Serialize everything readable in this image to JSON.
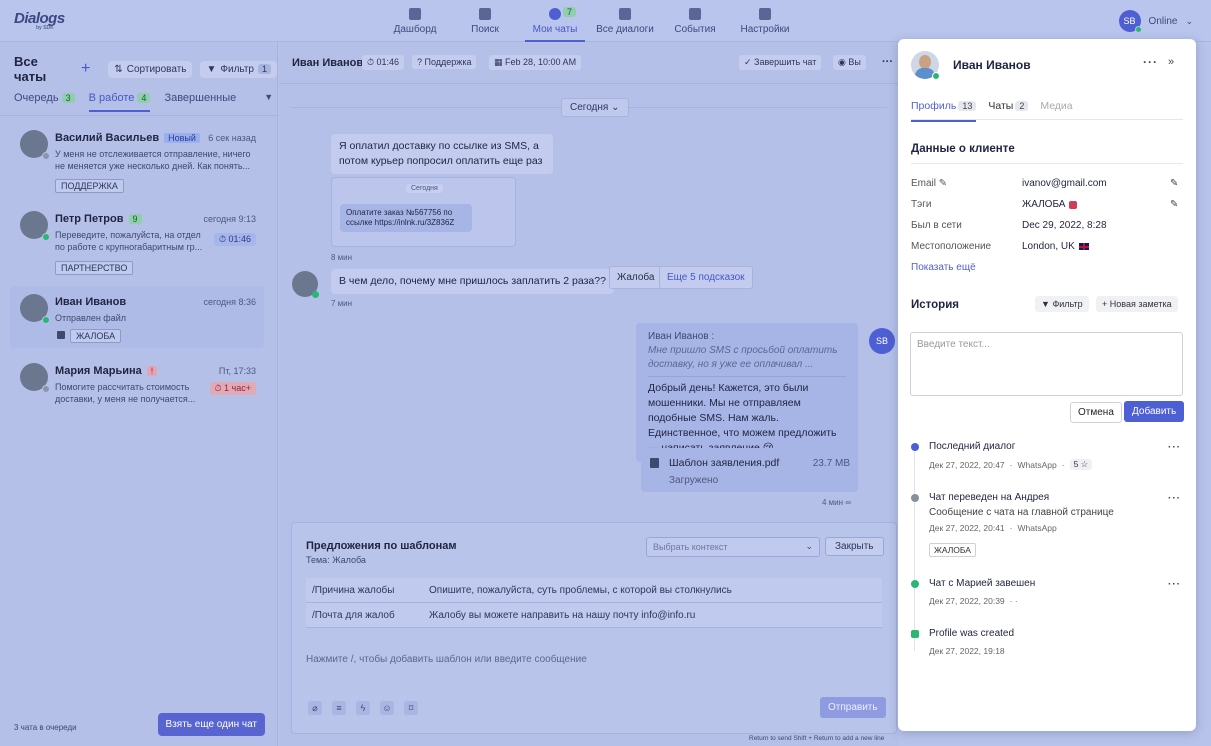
{
  "app": {
    "logo": "Dialogs",
    "logo_sub": "by SDK"
  },
  "nav": [
    {
      "label": "Дашборд",
      "icon": "dashboard-icon"
    },
    {
      "label": "Поиск",
      "icon": "search-icon"
    },
    {
      "label": "Мои чаты",
      "icon": "chats-icon",
      "badge": "7",
      "active": true
    },
    {
      "label": "Все диалоги",
      "icon": "dialogs-icon"
    },
    {
      "label": "События",
      "icon": "events-icon"
    },
    {
      "label": "Настройки",
      "icon": "settings-icon"
    }
  ],
  "user": {
    "initials": "SB",
    "status": "Online"
  },
  "left": {
    "title": "Все чаты",
    "sort_label": "Сортировать",
    "filter_label": "Фильтр",
    "filter_count": "1",
    "tabs": [
      {
        "label": "Очередь",
        "count": "3"
      },
      {
        "label": "В работе",
        "count": "4"
      },
      {
        "label": "Завершенные"
      }
    ],
    "chats": [
      {
        "name": "Василий Васильев",
        "badge": "Новый",
        "time": "6 сек назад",
        "text": "У меня не отслеживается отправление, ничего не меняется уже несколько дней. Как понять...",
        "tag": "ПОДДЕРЖКА"
      },
      {
        "name": "Петр Петров",
        "badge": "9",
        "time": "сегодня 9:13",
        "text": "Переведите, пожалуйста, на отдел по работе с крупногабаритным гр...",
        "timer": "01:46",
        "tag": "ПАРТНЕРСТВО"
      },
      {
        "name": "Иван Иванов",
        "time": "сегодня 8:36",
        "text": "Отправлен файл",
        "tag": "ЖАЛОБА"
      },
      {
        "name": "Мария Марьина",
        "badge": "!",
        "time": "Пт, 17:33",
        "text": "Помогите рассчитать стоимость доставки, у меня не получается...",
        "timer": "1 час+"
      }
    ],
    "queue_text": "3 чата в очереди",
    "take_button": "Взять еще один чат"
  },
  "chat": {
    "name": "Иван Иванов",
    "timer": "01:46",
    "topic": "Поддержка",
    "date": "Feb 28, 10:00 AM",
    "finish_label": "Завершить чат",
    "assignee": "Вы",
    "today": "Сегодня",
    "msg1": "Я оплатил доставку по ссылке из SMS, а потом курьер попросил оплатить еще раз",
    "preview_today": "Сегодня",
    "preview_text": "Оплатите заказ №567756 по ссылке https://inlnk.ru/3Z836Z",
    "meta1": "8 мин",
    "msg2": "В чем дело, почему мне пришлось заплатить 2 раза??",
    "meta2": "7 мин",
    "suggest1": "Жалоба",
    "suggest_more": "Еще 5 подсказок",
    "quote_author": "Иван Иванов :",
    "quote_text": "Мне пришло SMS с просьбой оплатить доставку, но я уже ее оплачивал ...",
    "reply": "Добрый день! Кажется, это были мошенники. Мы не отправляем подобные SMS. Нам жаль. Единственное, что можем предложить — написать заявление 😢",
    "agent_initials": "SB",
    "file_name": "Шаблон заявления.pdf",
    "file_size": "23.7 MB",
    "file_status": "Загружено",
    "meta3": "4 мин"
  },
  "templates": {
    "title": "Предложения по шаблонам",
    "subtitle": "Тема: Жалоба",
    "context_placeholder": "Выбрать контекст",
    "close_label": "Закрыть",
    "rows": [
      {
        "key": "/Причина жалобы",
        "value": "Опишите, пожалуйста, суть проблемы, с которой вы столкнулись"
      },
      {
        "key": "/Почта для жалоб",
        "value": "Жалобу вы можете направить на нашу почту info@info.ru"
      }
    ],
    "hint": "Нажмите /, чтобы добавить шаблон или введите сообщение",
    "send_label": "Отправить",
    "kbd_hint": "Return to send   Shift + Return to add a new line"
  },
  "profile": {
    "name": "Иван Иванов",
    "tabs": [
      {
        "label": "Профиль",
        "count": "13"
      },
      {
        "label": "Чаты",
        "count": "2"
      },
      {
        "label": "Медиа"
      }
    ],
    "section_title": "Данные о клиенте",
    "fields": [
      {
        "label": "Email",
        "value": "ivanov@gmail.com"
      },
      {
        "label": "Тэги",
        "value": "ЖАЛОБА"
      },
      {
        "label": "Был в сети",
        "value": "Dec 29, 2022, 8:28"
      },
      {
        "label": "Местоположение",
        "value": "London, UK"
      }
    ],
    "show_more": "Показать ещё",
    "history_title": "История",
    "filter_label": "Фильтр",
    "new_note_label": "Новая заметка",
    "note_placeholder": "Введите текст...",
    "cancel_label": "Отмена",
    "add_label": "Добавить",
    "history": [
      {
        "title": "Последний диалог",
        "date": "Дек 27, 2022, 20:47",
        "channel": "WhatsApp",
        "rating": "5 ☆",
        "color": "#4e5fd3"
      },
      {
        "title": "Чат переведен на Андрея",
        "sub": "Сообщение с чата на главной странице",
        "date": "Дек 27, 2022, 20:41",
        "channel": "WhatsApp",
        "tag": "ЖАЛОБА",
        "color": "#8a8f9e"
      },
      {
        "title": "Чат с Марией завешен",
        "date": "Дек 27, 2022, 20:39",
        "color": "#2bb673"
      },
      {
        "title": "Profile was created",
        "date": "Дек 27, 2022, 19:18",
        "color": "#2bb673"
      }
    ]
  }
}
